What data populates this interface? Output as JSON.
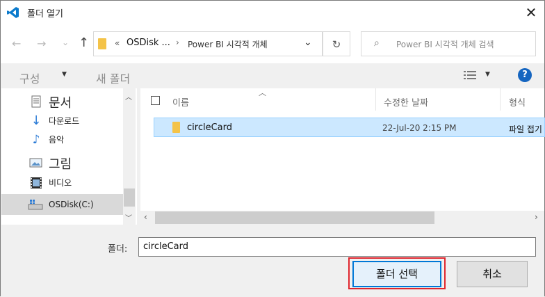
{
  "window": {
    "title": "폴더 열기"
  },
  "nav": {
    "address_prefix": "«",
    "breadcrumb": [
      "OSDisk ...",
      "Power BI 시각적 개체"
    ],
    "search_placeholder": "Power BI 시각적 개체 검색"
  },
  "toolbar": {
    "organize_label": "구성",
    "new_folder_label": "새 폴더",
    "help_label": "?"
  },
  "sidebar": {
    "items": [
      {
        "label": "문서",
        "icon": "document-icon"
      },
      {
        "label": "다운로드",
        "icon": "download-icon"
      },
      {
        "label": "음악",
        "icon": "music-icon"
      },
      {
        "label": "그림",
        "icon": "picture-icon"
      },
      {
        "label": "비디오",
        "icon": "video-icon"
      },
      {
        "label": "OSDisk(C:)",
        "icon": "drive-icon"
      }
    ]
  },
  "columns": {
    "name": "이름",
    "modified": "수정한 날짜",
    "type": "형식"
  },
  "files": [
    {
      "name": "circleCard",
      "modified": "22-Jul-20 2:15 PM",
      "type": "파일 접기",
      "selected": true
    }
  ],
  "footer": {
    "folder_label": "폴더:",
    "folder_value": "circleCard",
    "select_button": "폴더 선택",
    "cancel_button": "취소"
  },
  "colors": {
    "accent": "#0078d7",
    "selection": "#cce8ff",
    "highlight_outline": "#e0262e"
  }
}
